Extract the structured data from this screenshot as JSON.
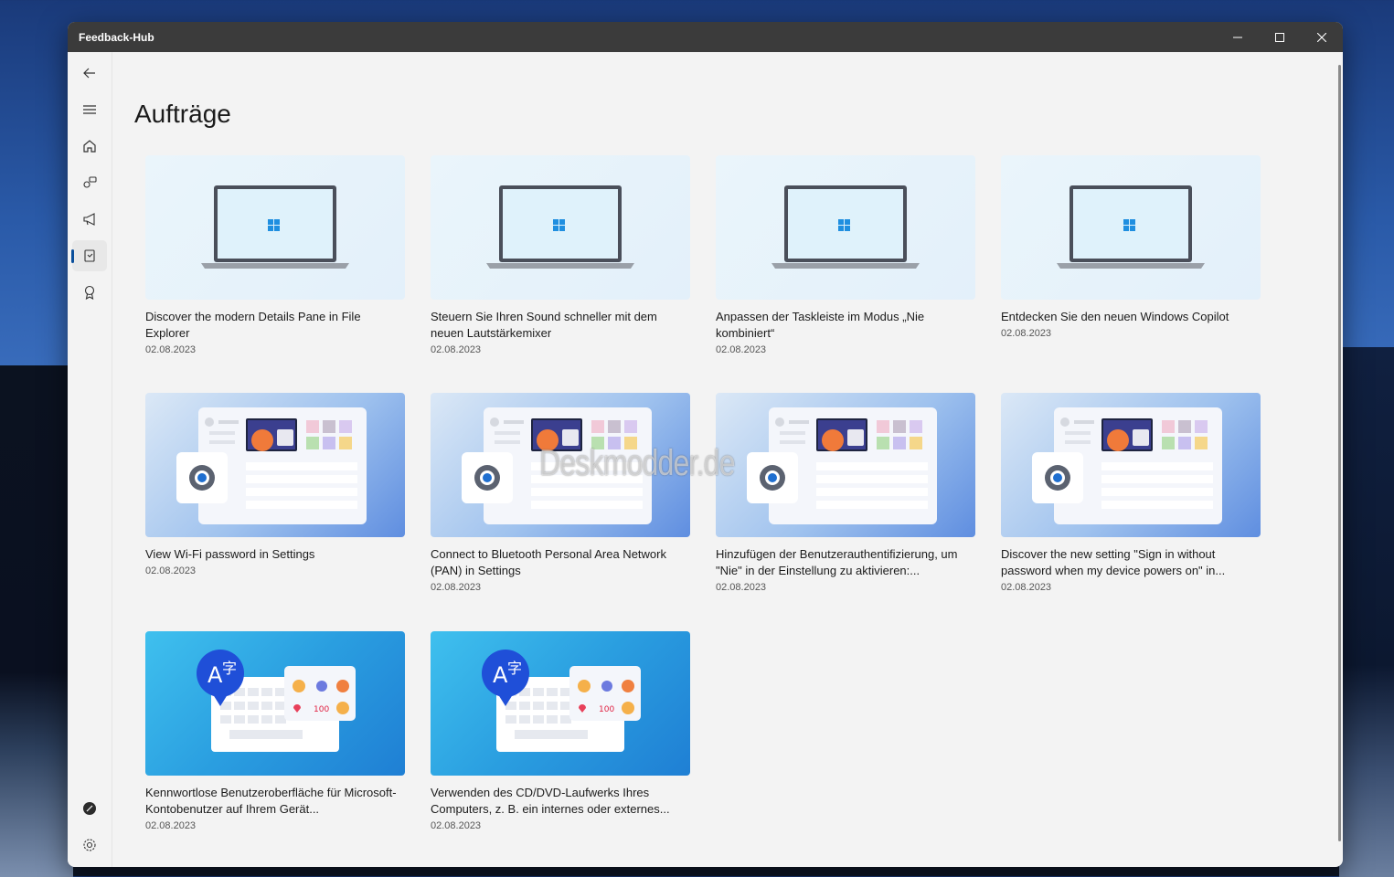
{
  "app": {
    "title": "Feedback-Hub"
  },
  "page": {
    "title": "Aufträge"
  },
  "watermark": "Deskmodder.de",
  "sidebar": {
    "items": [
      {
        "name": "back-icon"
      },
      {
        "name": "menu-icon"
      },
      {
        "name": "home-icon"
      },
      {
        "name": "feedback-icon"
      },
      {
        "name": "announcements-icon"
      },
      {
        "name": "quests-icon",
        "active": true
      },
      {
        "name": "achievements-icon"
      },
      {
        "name": "profile-icon"
      },
      {
        "name": "settings-icon"
      }
    ]
  },
  "cards": [
    {
      "title": "Discover the modern Details Pane in File Explorer",
      "date": "02.08.2023",
      "thumb": "laptop"
    },
    {
      "title": "Steuern Sie Ihren Sound schneller mit dem neuen Lautstärkemixer",
      "date": "02.08.2023",
      "thumb": "laptop"
    },
    {
      "title": "Anpassen der Taskleiste im Modus „Nie kombiniert“",
      "date": "02.08.2023",
      "thumb": "laptop"
    },
    {
      "title": "Entdecken Sie den neuen Windows Copilot",
      "date": "02.08.2023",
      "thumb": "laptop"
    },
    {
      "title": "View Wi-Fi password in Settings",
      "date": "02.08.2023",
      "thumb": "settings"
    },
    {
      "title": "Connect to Bluetooth Personal Area Network (PAN) in Settings",
      "date": "02.08.2023",
      "thumb": "settings"
    },
    {
      "title": "Hinzufügen der Benutzerauthentifizierung, um \"Nie\" in der Einstellung zu aktivieren:...",
      "date": "02.08.2023",
      "thumb": "settings"
    },
    {
      "title": "Discover the new setting \"Sign in without password when my device powers on\" in...",
      "date": "02.08.2023",
      "thumb": "settings"
    },
    {
      "title": "Kennwortlose Benutzeroberfläche für Microsoft-Kontobenutzer auf Ihrem Gerät...",
      "date": "02.08.2023",
      "thumb": "keyboard"
    },
    {
      "title": "Verwenden des CD/DVD-Laufwerks Ihres Computers, z. B. ein internes oder externes...",
      "date": "02.08.2023",
      "thumb": "keyboard"
    }
  ]
}
